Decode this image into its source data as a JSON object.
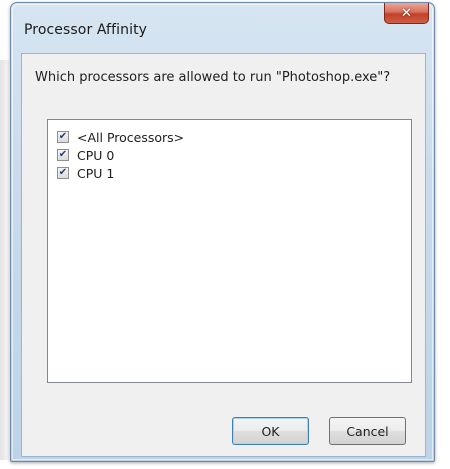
{
  "window": {
    "title": "Processor Affinity",
    "close_glyph": "✕"
  },
  "prompt": "Which processors are allowed to run \"Photoshop.exe\"?",
  "processors": [
    {
      "label": "<All Processors>",
      "checked": true
    },
    {
      "label": "CPU 0",
      "checked": true
    },
    {
      "label": "CPU 1",
      "checked": true
    }
  ],
  "check_glyph": "✔",
  "buttons": {
    "ok": "OK",
    "cancel": "Cancel"
  },
  "colors": {
    "frame": "#c9dbec",
    "close_button": "#c1402a",
    "client_bg": "#f0f0f0",
    "check_mark": "#253f75"
  }
}
